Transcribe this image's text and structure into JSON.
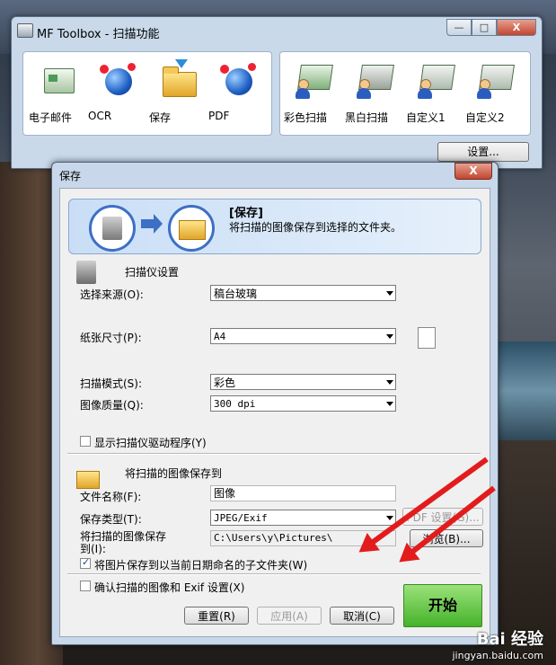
{
  "toolbox": {
    "title": "MF Toolbox - 扫描功能",
    "controls": {
      "minimize": "—",
      "maximize": "□",
      "close": "X"
    },
    "left_tools": [
      {
        "label": "电子邮件",
        "icon": "email-icon"
      },
      {
        "label": "OCR",
        "icon": "ocr-icon"
      },
      {
        "label": "保存",
        "icon": "save-folder-icon"
      },
      {
        "label": "PDF",
        "icon": "pdf-icon"
      }
    ],
    "right_tools": [
      {
        "label": "彩色扫描",
        "icon": "color-scan-icon"
      },
      {
        "label": "黑白扫描",
        "icon": "bw-scan-icon"
      },
      {
        "label": "自定义1",
        "icon": "custom1-icon"
      },
      {
        "label": "自定义2",
        "icon": "custom2-icon"
      }
    ],
    "settings_button": "设置..."
  },
  "dialog": {
    "title": "保存",
    "close": "X",
    "banner": {
      "title": "[保存]",
      "description": "将扫描的图像保存到选择的文件夹。"
    },
    "scanner_section": {
      "title": "扫描仪设置",
      "source_label": "选择来源(O):",
      "source_value": "稿台玻璃",
      "paper_label": "纸张尺寸(P):",
      "paper_value": "A4",
      "mode_label": "扫描模式(S):",
      "mode_value": "彩色",
      "quality_label": "图像质量(Q):",
      "quality_value": "300 dpi",
      "show_driver_label": "显示扫描仪驱动程序(Y)",
      "show_driver_checked": false
    },
    "save_section": {
      "title": "将扫描的图像保存到",
      "filename_label": "文件名称(F):",
      "filename_value": "图像",
      "filetype_label": "保存类型(T):",
      "filetype_value": "JPEG/Exif",
      "pdf_settings_button": "PDF 设置(G)...",
      "savepath_label_1": "将扫描的图像保存",
      "savepath_label_2": "到(I):",
      "savepath_value": "C:\\Users\\y\\Pictures\\",
      "browse_button": "浏览(B)...",
      "subfolder_label": "将图片保存到以当前日期命名的子文件夹(W)",
      "subfolder_checked": true
    },
    "confirm_label": "确认扫描的图像和 Exif 设置(X)",
    "confirm_checked": false,
    "buttons": {
      "reset": "重置(R)",
      "apply": "应用(A)",
      "cancel": "取消(C)",
      "start": "开始"
    }
  },
  "watermark": {
    "main": "Bai 经验",
    "sub": "jingyan.baidu.com"
  },
  "colors": {
    "annotation_arrow": "#e21c1c",
    "start_button": "#5ec23a",
    "banner": "#c9def6"
  }
}
